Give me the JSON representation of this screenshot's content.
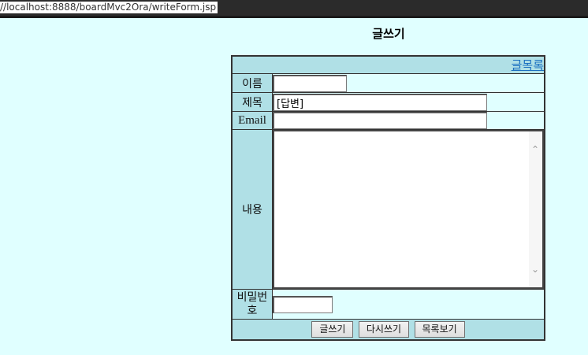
{
  "browser": {
    "url": "//localhost:8888/boardMvc2Ora/writeForm.jsp"
  },
  "page": {
    "title": "글쓰기"
  },
  "form": {
    "list_link": "글목록",
    "name_label": "이름",
    "name_value": "",
    "subject_label": "제목",
    "subject_value": "[답변]",
    "email_label": "Email",
    "email_value": "",
    "content_label": "내용",
    "content_value": "",
    "password_label": "비밀번호",
    "password_value": ""
  },
  "buttons": {
    "write": "글쓰기",
    "reset": "다시쓰기",
    "list": "목록보기"
  },
  "colors": {
    "background": "#e0ffff",
    "label_cell": "#b0e0e6",
    "link": "#1a6fc0"
  }
}
